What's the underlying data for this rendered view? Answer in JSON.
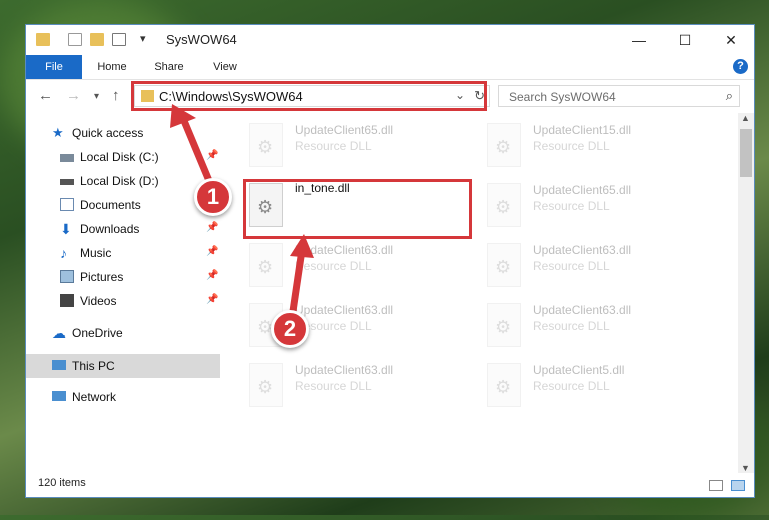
{
  "window": {
    "title": "SysWOW64"
  },
  "window_controls": {
    "minimize": "—",
    "maximize": "☐",
    "close": "✕"
  },
  "ribbon": {
    "tabs": [
      "File",
      "Home",
      "Share",
      "View"
    ],
    "help": "?"
  },
  "nav": {
    "address": "C:\\Windows\\SysWOW64",
    "search_placeholder": "Search SysWOW64"
  },
  "sidebar": {
    "items": [
      {
        "label": "Quick access",
        "icon": "star-icon"
      },
      {
        "label": "Local Disk (C:)",
        "icon": "drive-icon",
        "pinned": true
      },
      {
        "label": "Local Disk (D:)",
        "icon": "drive-icon"
      },
      {
        "label": "Documents",
        "icon": "document-icon"
      },
      {
        "label": "Downloads",
        "icon": "download-icon",
        "pinned": true
      },
      {
        "label": "Music",
        "icon": "music-icon",
        "pinned": true
      },
      {
        "label": "Pictures",
        "icon": "picture-icon",
        "pinned": true
      },
      {
        "label": "Videos",
        "icon": "video-icon",
        "pinned": true
      },
      {
        "label": "OneDrive",
        "icon": "cloud-icon"
      },
      {
        "label": "This PC",
        "icon": "computer-icon",
        "selected": true
      },
      {
        "label": "Network",
        "icon": "network-icon"
      }
    ]
  },
  "files": [
    {
      "name": "UpdateClient65.dll",
      "type": "Resource DLL",
      "faded": true
    },
    {
      "name": "UpdateClient15.dll",
      "type": "Resource DLL",
      "faded": true
    },
    {
      "name": "in_tone.dll",
      "type": "",
      "faded": false
    },
    {
      "name": "UpdateClient65.dll",
      "type": "Resource DLL",
      "faded": true
    },
    {
      "name": "UpdateClient63.dll",
      "type": "Resource DLL",
      "faded": true
    },
    {
      "name": "UpdateClient63.dll",
      "type": "Resource DLL",
      "faded": true
    },
    {
      "name": "UpdateClient63.dll",
      "type": "Resource DLL",
      "faded": true
    },
    {
      "name": "UpdateClient63.dll",
      "type": "Resource DLL",
      "faded": true
    },
    {
      "name": "UpdateClient63.dll",
      "type": "Resource DLL",
      "faded": true
    },
    {
      "name": "UpdateClient5.dll",
      "type": "Resource DLL",
      "faded": true
    }
  ],
  "status": {
    "item_count": "120 items"
  },
  "annotations": {
    "badge1": "1",
    "badge2": "2",
    "color": "#d5373a"
  }
}
